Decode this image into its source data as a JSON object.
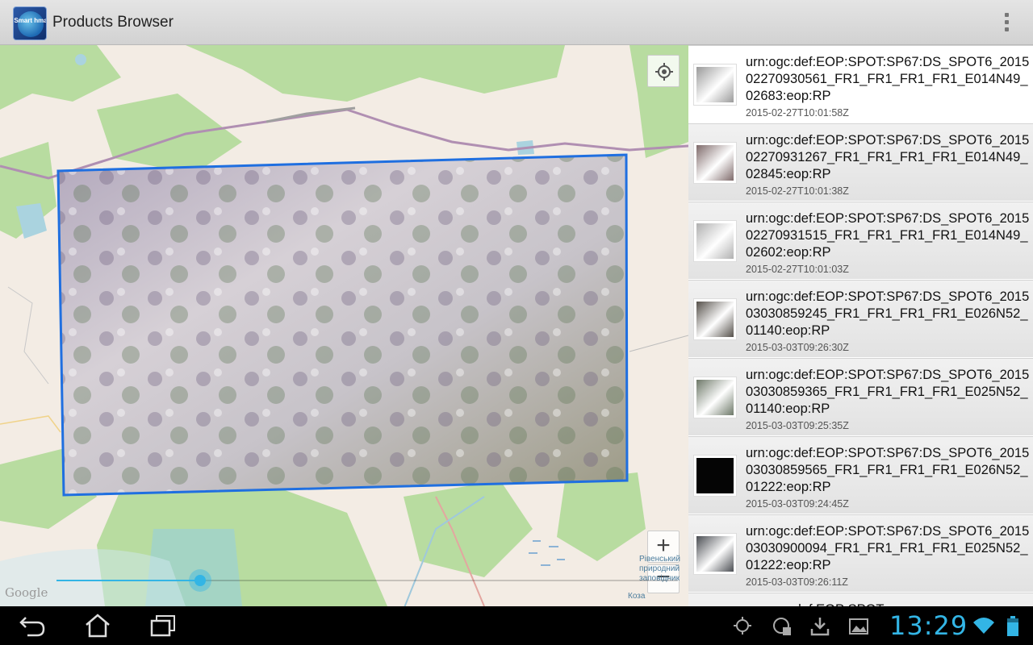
{
  "app": {
    "title": "Products Browser",
    "icon_text": "Smart hma",
    "menu_icon": "overflow-menu-icon"
  },
  "map": {
    "attribution": "Google",
    "labels": [
      "Рівенський природний заповідник",
      "Коза"
    ],
    "timeline_progress": 0.23,
    "buttons": {
      "locate_icon": "my-location-icon",
      "zoom_in": "+",
      "zoom_out": "−"
    }
  },
  "products": [
    {
      "title": "urn:ogc:def:EOP:SPOT:SP67:DS_SPOT6_201502270930561_FR1_FR1_FR1_FR1_E014N49_02683:eop:RP",
      "date": "2015-02-27T10:01:58Z",
      "selected": true,
      "thumb_color": "#9a9a9a"
    },
    {
      "title": "urn:ogc:def:EOP:SPOT:SP67:DS_SPOT6_201502270931267_FR1_FR1_FR1_FR1_E014N49_02845:eop:RP",
      "date": "2015-02-27T10:01:38Z",
      "selected": false,
      "thumb_color": "#7e6a6a"
    },
    {
      "title": "urn:ogc:def:EOP:SPOT:SP67:DS_SPOT6_201502270931515_FR1_FR1_FR1_FR1_E014N49_02602:eop:RP",
      "date": "2015-02-27T10:01:03Z",
      "selected": false,
      "thumb_color": "#b0b0b0"
    },
    {
      "title": "urn:ogc:def:EOP:SPOT:SP67:DS_SPOT6_201503030859245_FR1_FR1_FR1_FR1_E026N52_01140:eop:RP",
      "date": "2015-03-03T09:26:30Z",
      "selected": false,
      "thumb_color": "#55504a"
    },
    {
      "title": "urn:ogc:def:EOP:SPOT:SP67:DS_SPOT6_201503030859365_FR1_FR1_FR1_FR1_E025N52_01140:eop:RP",
      "date": "2015-03-03T09:25:35Z",
      "selected": false,
      "thumb_color": "#6d7868"
    },
    {
      "title": "urn:ogc:def:EOP:SPOT:SP67:DS_SPOT6_201503030859565_FR1_FR1_FR1_FR1_E026N52_01222:eop:RP",
      "date": "2015-03-03T09:24:45Z",
      "selected": false,
      "thumb_color": "#050505"
    },
    {
      "title": "urn:ogc:def:EOP:SPOT:SP67:DS_SPOT6_201503030900094_FR1_FR1_FR1_FR1_E025N52_01222:eop:RP",
      "date": "2015-03-03T09:26:11Z",
      "selected": false,
      "thumb_color": "#4a4d52"
    },
    {
      "title": "urn:ogc:def:EOP:SPOT:",
      "date": "",
      "selected": false,
      "thumb_color": "#888888"
    }
  ],
  "status": {
    "time": "13:29",
    "nav_icons": [
      "back-icon",
      "home-icon",
      "recent-apps-icon"
    ],
    "tray_icons": [
      "gps-icon",
      "app-notification-icon",
      "download-icon",
      "gallery-icon",
      "wifi-icon",
      "battery-icon"
    ],
    "accent": "#33b5e5"
  }
}
